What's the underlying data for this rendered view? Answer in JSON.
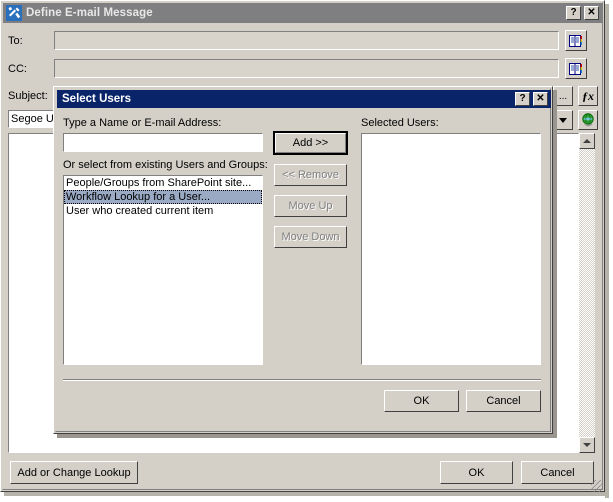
{
  "outer_window": {
    "title": "Define E-mail Message",
    "app_icon": "sharepoint-designer-icon",
    "titlebar_buttons": [
      {
        "name": "help-button",
        "label": "?"
      },
      {
        "name": "close-button",
        "label": "✕"
      }
    ],
    "fields": [
      {
        "name": "to",
        "label": "To:",
        "value": "",
        "placeholder": "",
        "picker_icon": "address-book-icon"
      },
      {
        "name": "cc",
        "label": "CC:",
        "value": "",
        "placeholder": "",
        "picker_icon": "address-book-icon"
      },
      {
        "name": "subject",
        "label": "Subject:",
        "value": "",
        "placeholder": "",
        "ellipsis_label": "...",
        "fx_label": "ƒx"
      }
    ],
    "font_name_value": "Segoe UI",
    "toolbar": {
      "dropdown_label": "▼",
      "globe_icon": "globe-icon"
    },
    "body_value": "",
    "scrollbar": {
      "up_arrow": "scroll-up-arrow",
      "down_arrow": "scroll-down-arrow"
    },
    "buttons": [
      {
        "name": "add-or-change-lookup-button",
        "label": "Add or Change Lookup"
      },
      {
        "name": "ok-button",
        "label": "OK"
      },
      {
        "name": "cancel-button",
        "label": "Cancel"
      }
    ]
  },
  "select_users_dialog": {
    "title": "Select Users",
    "titlebar_buttons": [
      {
        "name": "help-button",
        "label": "?"
      },
      {
        "name": "close-button",
        "label": "✕"
      }
    ],
    "name_label": "Type a Name or E-mail Address:",
    "name_value": "",
    "existing_label": "Or select from existing Users and Groups:",
    "existing_items": [
      {
        "label": "People/Groups from SharePoint site...",
        "selected": false
      },
      {
        "label": "Workflow Lookup for a User...",
        "selected": true
      },
      {
        "label": "User who created current item",
        "selected": false
      }
    ],
    "selected_users_label": "Selected Users:",
    "selected_users_items": [],
    "transfer_buttons": [
      {
        "name": "add-button",
        "label": "Add >>",
        "disabled": false,
        "default": true
      },
      {
        "name": "remove-button",
        "label": "<< Remove",
        "disabled": true,
        "default": false
      },
      {
        "name": "move-up-button",
        "label": "Move Up",
        "disabled": true,
        "default": false
      },
      {
        "name": "move-down-button",
        "label": "Move Down",
        "disabled": true,
        "default": false
      }
    ],
    "footer_buttons": [
      {
        "name": "ok-button",
        "label": "OK"
      },
      {
        "name": "cancel-button",
        "label": "Cancel"
      }
    ]
  },
  "colors": {
    "window_face": "#d4d0c8",
    "inactive_titlebar": "#7f7f81",
    "active_titlebar": "#0a246a",
    "selection": "#9aaac4",
    "app_icon_blue": "#2a6fbb"
  }
}
